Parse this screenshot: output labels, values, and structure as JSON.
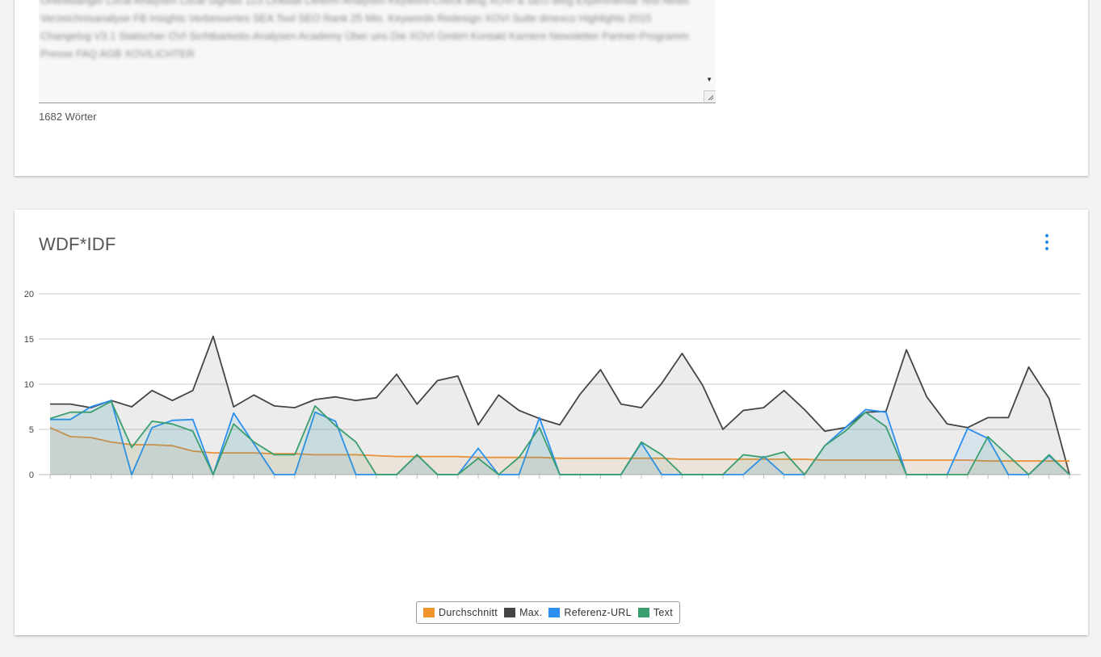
{
  "text_panel": {
    "textarea_text": "Onlinebanger Local Analysen Local Signals 123 Linkbalt Lieferm Analysen Keyword-Check Blog XOVI & SEO Blog Experimental Test News Verzeichnisanalyse FB Insights Verbessertes SEA Tool SEO Rank 25 Mio. Keywords Redesign XOVI Suite dmexco Highlights 2015 Changelog V3.1 Statischer OVI Sichtbarkeits-Analysen Academy Über uns Die XOVI GmbH Kontakt Karriere Newsletter Partner-Programm Presse FAQ AGB XOVILICHTER",
    "word_count": "1682 Wörter"
  },
  "chart_card": {
    "title": "WDF*IDF",
    "menu_icon": "more-vert-icon"
  },
  "colors": {
    "durchschnitt": "#e8903a",
    "max": "#444444",
    "referenz": "#2b8fef",
    "text": "#3a9e6e"
  },
  "chart_data": {
    "type": "line",
    "title": "WDF*IDF",
    "ylim": [
      0,
      20
    ],
    "yticks": [
      0,
      5,
      10,
      15,
      20
    ],
    "grid": true,
    "legend_position": "bottom",
    "categories": [
      "",
      "",
      "",
      "",
      "",
      "",
      "",
      "",
      "",
      "",
      "",
      "",
      "",
      "",
      "",
      "",
      "",
      "",
      "",
      "",
      "",
      "",
      "",
      "",
      "",
      "",
      "",
      "",
      "",
      "",
      "",
      "",
      "",
      "",
      "",
      "",
      "",
      "",
      "",
      "",
      "",
      "",
      "",
      "",
      "",
      "",
      "",
      "",
      "",
      "",
      ""
    ],
    "series": [
      {
        "name": "Durchschnitt",
        "values": [
          5.2,
          4.2,
          4.1,
          3.6,
          3.3,
          3.3,
          3.2,
          2.6,
          2.4,
          2.4,
          2.4,
          2.3,
          2.3,
          2.2,
          2.2,
          2.2,
          2.1,
          2.0,
          2.0,
          2.0,
          2.0,
          1.9,
          1.9,
          1.9,
          1.9,
          1.8,
          1.8,
          1.8,
          1.8,
          1.8,
          1.8,
          1.7,
          1.7,
          1.7,
          1.7,
          1.7,
          1.7,
          1.7,
          1.6,
          1.6,
          1.6,
          1.6,
          1.6,
          1.6,
          1.6,
          1.6,
          1.5,
          1.5,
          1.5,
          1.5,
          1.5
        ]
      },
      {
        "name": "Max.",
        "values": [
          7.8,
          7.8,
          7.4,
          8.2,
          7.5,
          9.3,
          8.2,
          9.3,
          15.3,
          7.5,
          8.8,
          7.6,
          7.4,
          8.3,
          8.6,
          8.2,
          8.5,
          11.1,
          7.8,
          10.4,
          10.9,
          5.5,
          8.8,
          7.1,
          6.2,
          5.5,
          8.9,
          11.6,
          7.8,
          7.4,
          10.1,
          13.4,
          9.9,
          5.0,
          7.1,
          7.4,
          9.3,
          7.2,
          4.8,
          5.2,
          6.9,
          7.0,
          13.8,
          8.6,
          5.6,
          5.2,
          6.3,
          6.3,
          11.9,
          8.4,
          0
        ]
      },
      {
        "name": "Referenz-URL",
        "values": [
          6.1,
          6.1,
          7.5,
          8.2,
          0,
          5.2,
          6.0,
          6.1,
          0,
          6.8,
          3.4,
          0,
          0,
          6.9,
          5.9,
          0,
          0,
          0,
          2.2,
          0,
          0,
          2.9,
          0,
          0,
          6.3,
          0,
          0,
          0,
          0,
          3.5,
          0,
          0,
          0,
          0,
          0,
          2.0,
          0,
          0,
          3.2,
          5.2,
          7.2,
          6.9,
          0,
          0,
          0,
          5.1,
          4.0,
          0,
          0,
          2.1,
          0
        ]
      },
      {
        "name": "Text",
        "values": [
          6.2,
          6.9,
          6.9,
          8.1,
          3.0,
          5.9,
          5.6,
          4.8,
          0,
          5.6,
          3.6,
          2.2,
          2.2,
          7.6,
          5.4,
          3.6,
          0,
          0,
          2.2,
          0,
          0,
          1.8,
          0,
          1.9,
          5.2,
          0,
          0,
          0,
          0,
          3.6,
          2.2,
          0,
          0,
          0,
          2.2,
          1.9,
          2.5,
          0,
          3.2,
          4.8,
          6.9,
          5.3,
          0,
          0,
          0,
          0,
          4.2,
          2.1,
          0,
          2.2,
          0
        ]
      }
    ]
  },
  "legend": [
    {
      "label": "Durchschnitt",
      "color": "#e8903a"
    },
    {
      "label": "Max.",
      "color": "#444444"
    },
    {
      "label": "Referenz-URL",
      "color": "#2b8fef"
    },
    {
      "label": "Text",
      "color": "#3a9e6e"
    }
  ]
}
